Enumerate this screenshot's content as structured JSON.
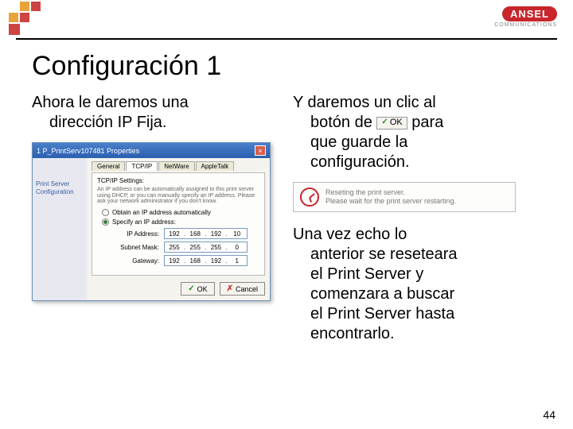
{
  "brand": {
    "name": "ANSEL",
    "sub": "COMMUNICATIONS"
  },
  "title": "Configuración 1",
  "left": {
    "line1": "Ahora le daremos una",
    "line2": "dirección IP Fija."
  },
  "right": {
    "p1a": "Y daremos un clic al",
    "p1b": "botón de",
    "p1c": "para",
    "p1d": "que guarde la",
    "p1e": "configuración.",
    "p2a": "Una vez echo lo",
    "p2b": "anterior se reseteara",
    "p2c": "el Print Server y",
    "p2d": "comenzara a buscar",
    "p2e": "el Print Server hasta",
    "p2f": "encontrarlo."
  },
  "dialog": {
    "title": "1 P_PrintServ107481 Properties",
    "side": "Print Server Configuration",
    "tabs": {
      "t1": "General",
      "t2": "TCP/IP",
      "t3": "NetWare",
      "t4": "AppleTalk"
    },
    "groupTitle": "TCP/IP Settings:",
    "desc": "An IP address can be automatically assigned to this print server using DHCP, or you can manually specify an IP address. Please ask your network administrator if you don't know.",
    "radio1": "Obtain an IP address automatically",
    "radio2": "Specify an IP address:",
    "labels": {
      "ip": "IP Address:",
      "mask": "Subnet Mask:",
      "gw": "Gateway:"
    },
    "ip": {
      "a": "192",
      "b": "168",
      "c": "192",
      "d": "10"
    },
    "mask": {
      "a": "255",
      "b": "255",
      "c": "255",
      "d": "0"
    },
    "gw": {
      "a": "192",
      "b": "168",
      "c": "192",
      "d": "1"
    },
    "ok": "OK",
    "cancel": "Cancel"
  },
  "inlineOk": "OK",
  "reset": {
    "line1": "Reseting the print server.",
    "line2": "Please wait for the print server restarting."
  },
  "page": "44"
}
